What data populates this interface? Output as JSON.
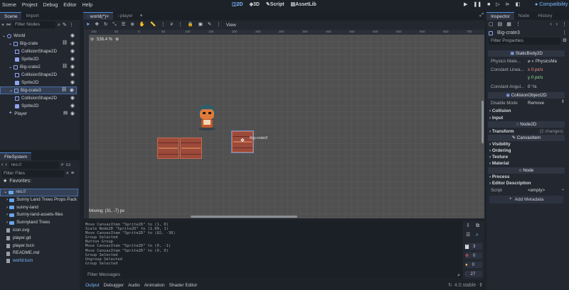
{
  "menu": [
    "Scene",
    "Project",
    "Debug",
    "Editor",
    "Help"
  ],
  "workspaces": [
    {
      "label": "2D",
      "icon": "2d-view-icon",
      "active": true
    },
    {
      "label": "3D",
      "icon": "3d-view-icon",
      "active": false
    },
    {
      "label": "Script",
      "icon": "script-icon",
      "active": false
    },
    {
      "label": "AssetLib",
      "icon": "assetlib-icon",
      "active": false
    }
  ],
  "renderer": "Compatibility",
  "scene_dock": {
    "tabs": [
      "Scene",
      "Import"
    ],
    "filter_placeholder": "Filter Nodes",
    "nodes": [
      {
        "label": "World",
        "indent": 0,
        "type": "node2d"
      },
      {
        "label": "Big-crate",
        "indent": 1,
        "type": "body"
      },
      {
        "label": "CollisionShape2D",
        "indent": 2,
        "type": "shape"
      },
      {
        "label": "Sprite2D",
        "indent": 2,
        "type": "sprite"
      },
      {
        "label": "Big-crate2",
        "indent": 1,
        "type": "body"
      },
      {
        "label": "CollisionShape2D",
        "indent": 2,
        "type": "shape"
      },
      {
        "label": "Sprite2D",
        "indent": 2,
        "type": "sprite"
      },
      {
        "label": "Big-crate3",
        "indent": 1,
        "type": "body",
        "selected": true
      },
      {
        "label": "CollisionShape2D",
        "indent": 2,
        "type": "shape"
      },
      {
        "label": "Sprite2D",
        "indent": 2,
        "type": "sprite"
      },
      {
        "label": "Player",
        "indent": 1,
        "type": "player"
      }
    ]
  },
  "filesystem": {
    "title": "FileSystem",
    "path": "res://",
    "filter_placeholder": "Filter Files",
    "favorites_label": "Favorites:",
    "entries": [
      {
        "label": "res://",
        "kind": "folder",
        "indent": 0,
        "selected": true
      },
      {
        "label": "Sunny Land Trees Props Pack",
        "kind": "folder",
        "indent": 1
      },
      {
        "label": "sunny-land",
        "kind": "folder",
        "indent": 1
      },
      {
        "label": "Sunny-land-assets-files",
        "kind": "folder",
        "indent": 1
      },
      {
        "label": "Sunnyland Trees",
        "kind": "folder",
        "indent": 1
      },
      {
        "label": "icon.svg",
        "kind": "file",
        "indent": 1
      },
      {
        "label": "player.gd",
        "kind": "file",
        "indent": 1
      },
      {
        "label": "player.tscn",
        "kind": "file",
        "indent": 1
      },
      {
        "label": "README.md",
        "kind": "file",
        "indent": 1
      },
      {
        "label": "world.tscn",
        "kind": "file",
        "indent": 1,
        "highlight": true
      }
    ]
  },
  "editor_tabs": [
    {
      "label": "world(*)",
      "active": true
    },
    {
      "label": "player",
      "active": false
    }
  ],
  "toolbar": {
    "view_label": "View"
  },
  "viewport": {
    "zoom": "536.4 %",
    "status": "Moving: (31, -7) px",
    "crate_label": "Big-crate3",
    "ruler_ticks": [
      "100",
      "50",
      "0",
      "50",
      "100",
      "150",
      "200",
      "250",
      "300",
      "350",
      "400",
      "450",
      "500",
      "550",
      "600",
      "650",
      "700"
    ]
  },
  "output": {
    "lines": [
      "Move CanvasItem \"Sprite2D\" to (1, 0)",
      "Scale Node2D \"Sprite2D\" to (1.09, 1)",
      "Move CanvasItem \"Sprite2D\" to (82, -36)",
      "Group Selected",
      "Button Group",
      "Move CanvasItem \"Sprite2D\" to (0, -1)",
      "Move CanvasItem \"Sprite2D\" to (0, 0)",
      "Group Selected",
      "Ungroup Selected",
      "Group Selected"
    ],
    "filter_placeholder": "Filter Messages",
    "counts": {
      "messages": "3",
      "errors": "0",
      "warnings": "0",
      "info": "27"
    }
  },
  "bottom_tabs": [
    "Output",
    "Debugger",
    "Audio",
    "Animation",
    "Shader Editor"
  ],
  "version": "4.0.stable",
  "inspector": {
    "tabs": [
      "Inspector",
      "Node",
      "History"
    ],
    "node_name": "Big-crate3",
    "filter_placeholder": "Filter Properties",
    "sections": {
      "static_body": "StaticBody2D",
      "collision_object": "CollisionObject2D",
      "node2d": "Node2D",
      "canvas_item": "CanvasItem",
      "node": "Node"
    },
    "props": {
      "physics_material_label": "Physics Mate...",
      "physics_material_value": "PhysicsMa",
      "linear_label": "Constant Linea...",
      "linear_x": "x  0 px/s",
      "linear_y": "y  0 px/s",
      "angular_label": "Constant Angul...",
      "angular_value": "0 °/s",
      "disable_mode_label": "Disable Mode",
      "disable_mode_value": "Remove",
      "script_label": "Script",
      "script_value": "<empty>"
    },
    "groups": {
      "collision": "Collision",
      "input": "Input",
      "transform": "Transform",
      "transform_hint": "(2 changes)",
      "visibility": "Visibility",
      "ordering": "Ordering",
      "texture": "Texture",
      "material": "Material",
      "process": "Process",
      "editor_description": "Editor Description"
    },
    "add_metadata": "Add Metadata"
  },
  "colors": {
    "accent": "#4c8ddd",
    "crate": "#9b4a3b",
    "viewport_bg": "#505050"
  }
}
